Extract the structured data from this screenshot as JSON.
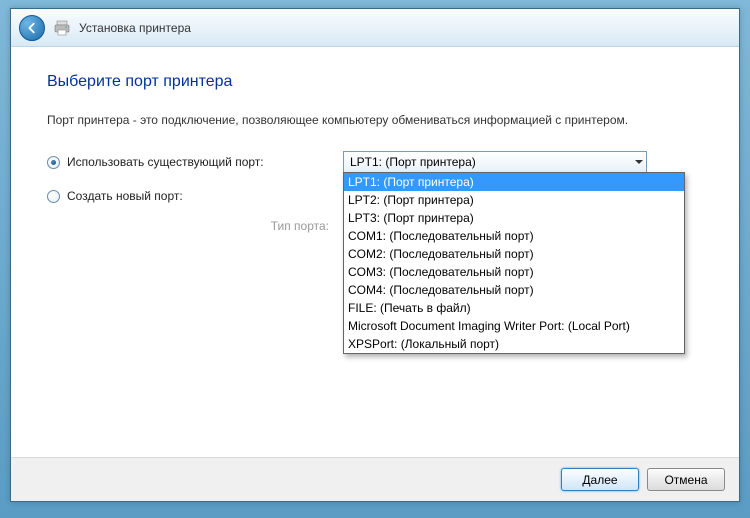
{
  "header": {
    "title": "Установка принтера"
  },
  "page": {
    "title": "Выберите порт принтера",
    "description": "Порт принтера - это подключение, позволяющее компьютеру обмениваться информацией с принтером."
  },
  "radios": {
    "use_existing": "Использовать существующий порт:",
    "create_new": "Создать новый порт:",
    "type_label": "Тип порта:"
  },
  "combo": {
    "selected": "LPT1: (Порт принтера)",
    "options": [
      "LPT1: (Порт принтера)",
      "LPT2: (Порт принтера)",
      "LPT3: (Порт принтера)",
      "COM1: (Последовательный порт)",
      "COM2: (Последовательный порт)",
      "COM3: (Последовательный порт)",
      "COM4: (Последовательный порт)",
      "FILE: (Печать в файл)",
      "Microsoft Document Imaging Writer Port: (Local Port)",
      "XPSPort: (Локальный порт)"
    ]
  },
  "buttons": {
    "next": "Далее",
    "cancel": "Отмена"
  }
}
